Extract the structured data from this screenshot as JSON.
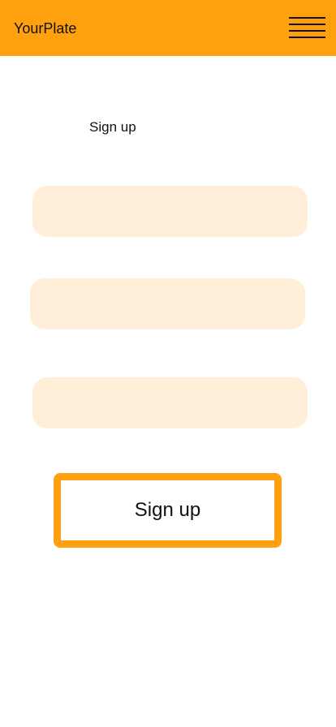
{
  "header": {
    "brand": "YourPlate",
    "menu_icon": "hamburger-menu-icon",
    "background_color": "#ffa10f"
  },
  "form": {
    "title": "Sign up",
    "fields": [
      {
        "value": "",
        "placeholder": ""
      },
      {
        "value": "",
        "placeholder": ""
      },
      {
        "value": "",
        "placeholder": ""
      }
    ],
    "field_color": "#ffefd9",
    "submit_label": "Sign up",
    "submit_border_color": "#ffa10f"
  }
}
